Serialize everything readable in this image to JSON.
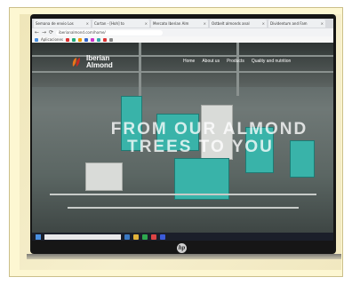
{
  "browser": {
    "tabs": [
      {
        "label": "Semana de envio Los"
      },
      {
        "label": "Cortan - [Hoh] to"
      },
      {
        "label": "Mercato Iberian Alm"
      },
      {
        "label": "Ostbelt almonds anal"
      },
      {
        "label": "Dividentum and Fam"
      }
    ],
    "url": "iberianalmond.com/home/",
    "bookmarks_label": "Aplicaciones"
  },
  "website": {
    "logo_line1": "Iberian",
    "logo_line2": "Almond",
    "nav": [
      "Home",
      "About us",
      "Products",
      "Quality and nutrition"
    ],
    "hero_line1": "FROM OUR ALMOND",
    "hero_line2": "TREES TO YOU"
  },
  "laptop": {
    "brand_mark": "hp"
  },
  "colors": {
    "machine_teal": "#39b3a9",
    "logo_orange": "#e8751a",
    "logo_red": "#c62a22"
  }
}
